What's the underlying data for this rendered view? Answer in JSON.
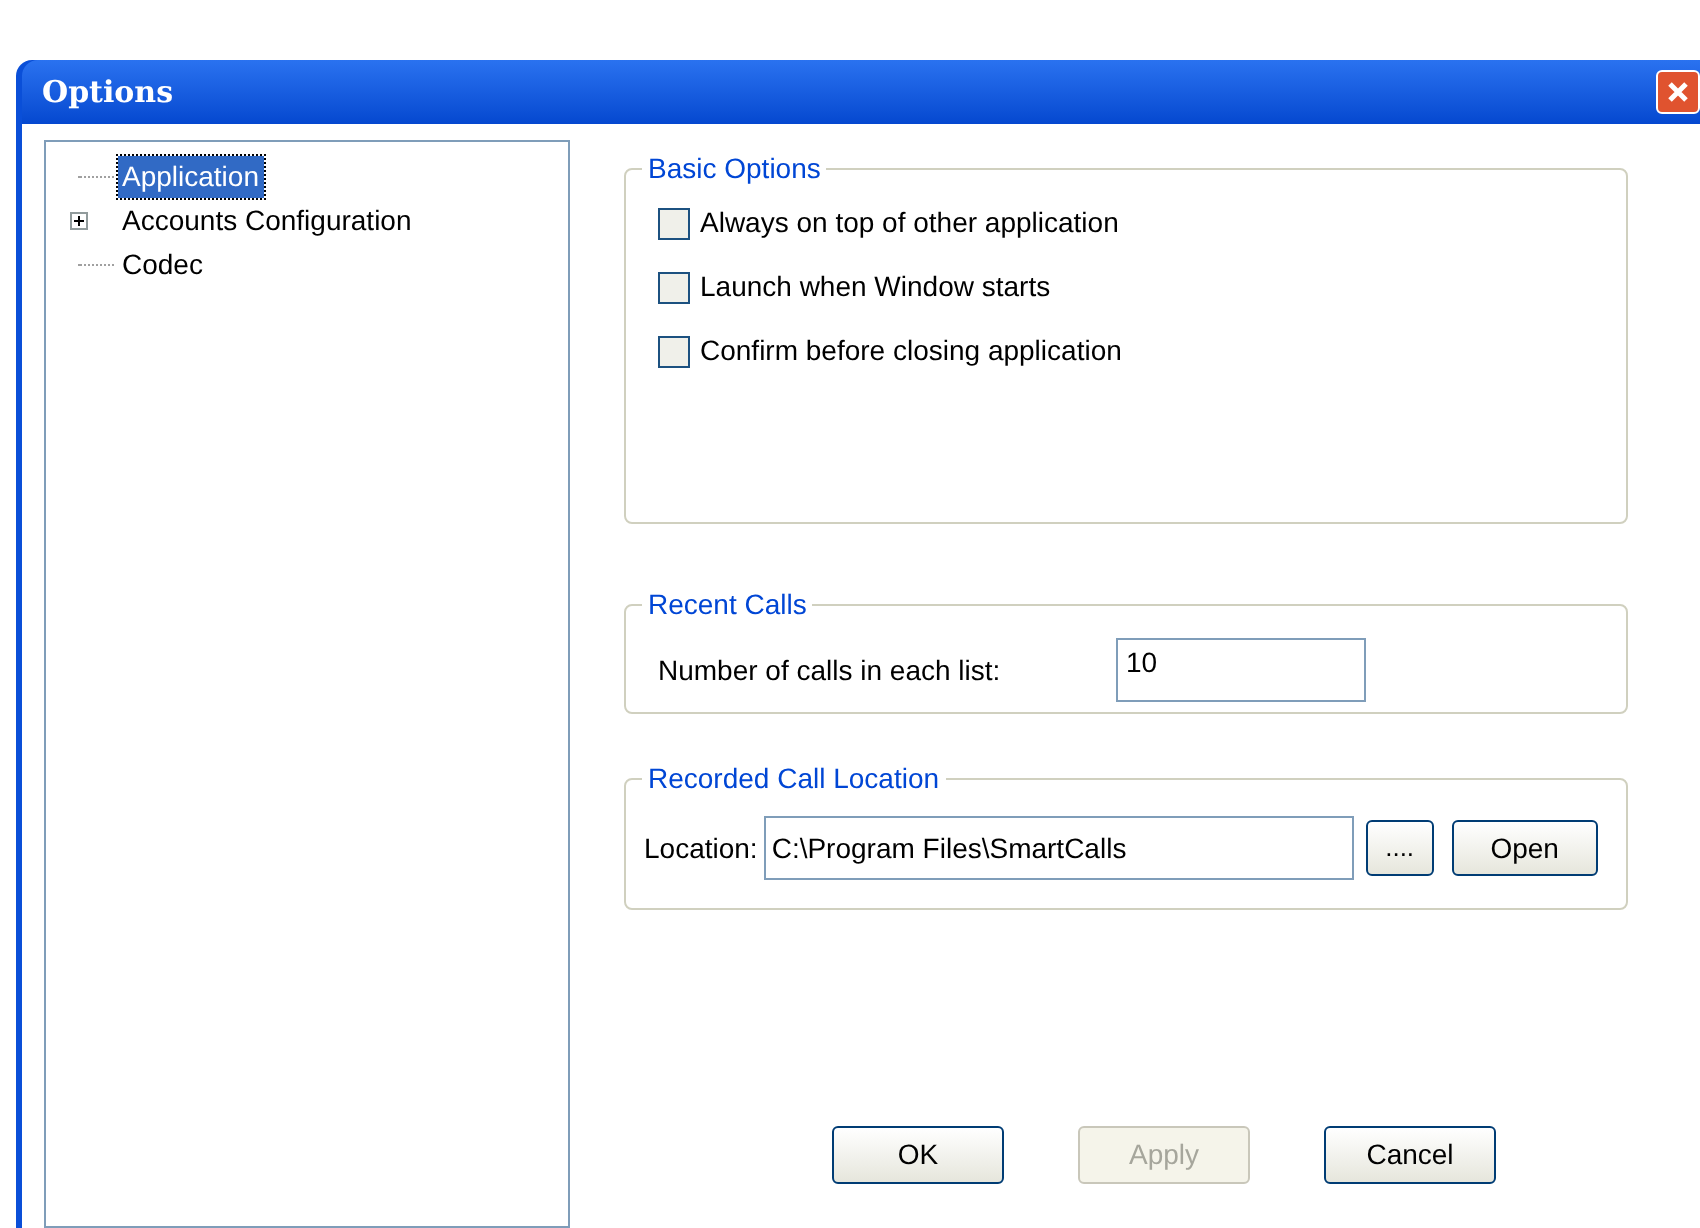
{
  "window": {
    "title": "Options"
  },
  "tree": [
    {
      "label": "Application",
      "selected": true
    },
    {
      "label": "Accounts Configuration",
      "selected": false,
      "expanded": false
    },
    {
      "label": "Codec",
      "selected": false
    }
  ],
  "basic_options": {
    "title": "Basic Options",
    "checkboxes": [
      {
        "label": "Always on top of other application",
        "checked": false
      },
      {
        "label": "Launch when Window starts",
        "checked": false
      },
      {
        "label": "Confirm before closing application",
        "checked": false
      }
    ]
  },
  "recent_calls": {
    "title": "Recent Calls",
    "label": "Number of calls in each list:",
    "value": "10"
  },
  "recorded_call_location": {
    "title": "Recorded Call Location",
    "label": "Location:",
    "value": "C:\\Program Files\\SmartCalls",
    "browse_button": "....",
    "open_button": "Open"
  },
  "buttons": [
    {
      "label": "OK",
      "disabled": false
    },
    {
      "label": "Apply",
      "disabled": true
    },
    {
      "label": "Cancel",
      "disabled": false
    }
  ]
}
